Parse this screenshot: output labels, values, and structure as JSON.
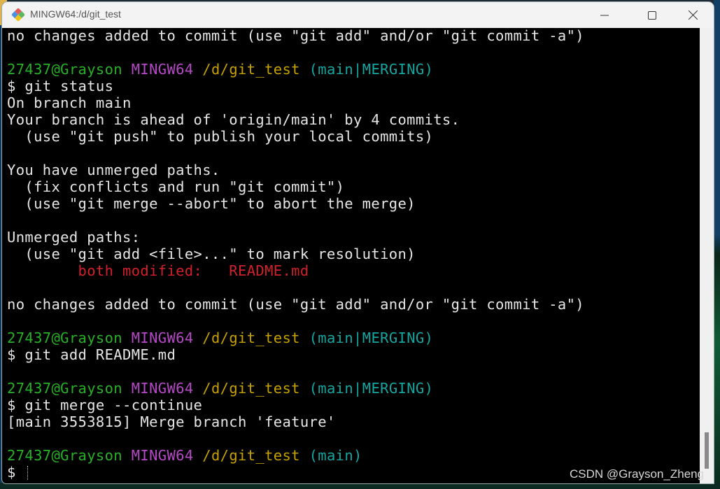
{
  "window": {
    "title": "MINGW64:/d/git_test",
    "icon": "git-icon",
    "controls": {
      "minimize": "minimize-icon",
      "maximize": "maximize-icon",
      "close": "close-icon"
    }
  },
  "colors": {
    "user_host": "#27b127",
    "system": "#b648c8",
    "path": "#c6a100",
    "branch": "#14a6a0",
    "conflict": "#d2202c",
    "text": "#e6e6e6",
    "background": "#000000"
  },
  "terminal": {
    "lines": [
      {
        "type": "text",
        "text": "no changes added to commit (use \"git add\" and/or \"git commit -a\")"
      },
      {
        "type": "blank"
      },
      {
        "type": "prompt",
        "user": "27437@Grayson",
        "system": "MINGW64",
        "path": "/d/git_test",
        "branch": "(main|MERGING)"
      },
      {
        "type": "text",
        "text": "$ git status"
      },
      {
        "type": "text",
        "text": "On branch main"
      },
      {
        "type": "text",
        "text": "Your branch is ahead of 'origin/main' by 4 commits."
      },
      {
        "type": "text",
        "text": "  (use \"git push\" to publish your local commits)"
      },
      {
        "type": "blank"
      },
      {
        "type": "text",
        "text": "You have unmerged paths."
      },
      {
        "type": "text",
        "text": "  (fix conflicts and run \"git commit\")"
      },
      {
        "type": "text",
        "text": "  (use \"git merge --abort\" to abort the merge)"
      },
      {
        "type": "blank"
      },
      {
        "type": "text",
        "text": "Unmerged paths:"
      },
      {
        "type": "text",
        "text": "  (use \"git add <file>...\" to mark resolution)"
      },
      {
        "type": "conflict",
        "indent": "        ",
        "text": "both modified:   README.md"
      },
      {
        "type": "blank"
      },
      {
        "type": "text",
        "text": "no changes added to commit (use \"git add\" and/or \"git commit -a\")"
      },
      {
        "type": "blank"
      },
      {
        "type": "prompt",
        "user": "27437@Grayson",
        "system": "MINGW64",
        "path": "/d/git_test",
        "branch": "(main|MERGING)"
      },
      {
        "type": "text",
        "text": "$ git add README.md"
      },
      {
        "type": "blank"
      },
      {
        "type": "prompt",
        "user": "27437@Grayson",
        "system": "MINGW64",
        "path": "/d/git_test",
        "branch": "(main|MERGING)"
      },
      {
        "type": "text",
        "text": "$ git merge --continue"
      },
      {
        "type": "text",
        "text": "[main 3553815] Merge branch 'feature'"
      },
      {
        "type": "blank"
      },
      {
        "type": "prompt",
        "user": "27437@Grayson",
        "system": "MINGW64",
        "path": "/d/git_test",
        "branch": "(main)"
      },
      {
        "type": "input",
        "text": "$ "
      }
    ]
  },
  "watermark": "CSDN @Grayson_Zheng"
}
